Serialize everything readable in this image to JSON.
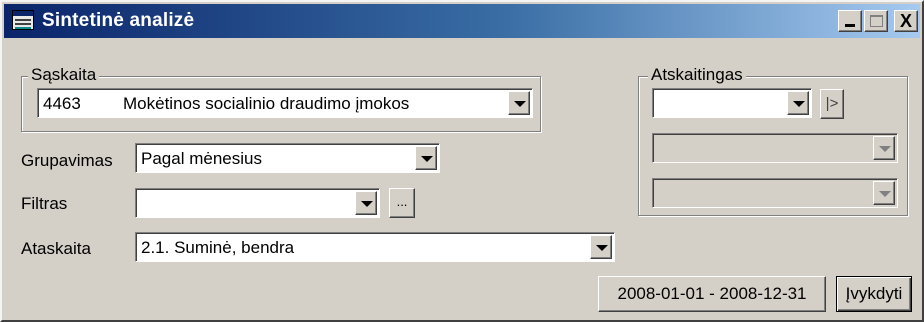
{
  "window": {
    "title": "Sintetinė analizė",
    "controls": {
      "minimize": "_",
      "maximize": "□",
      "close": "X"
    }
  },
  "account_group": {
    "label": "Sąskaita",
    "code": "4463",
    "name": "Mokėtinos socialinio draudimo įmokos"
  },
  "grouping": {
    "label": "Grupavimas",
    "value": "Pagal mėnesius"
  },
  "filter": {
    "label": "Filtras",
    "value": "",
    "ellipsis": "..."
  },
  "report": {
    "label": "Ataskaita",
    "value": "2.1. Suminė, bendra"
  },
  "accountable_group": {
    "label": "Atskaitingas",
    "next_button": "|>",
    "combos": [
      "",
      "",
      ""
    ]
  },
  "actions": {
    "period": "2008-01-01 - 2008-12-31",
    "execute": "Įvykdyti"
  },
  "colors": {
    "titlebar_start": "#0a246a",
    "titlebar_end": "#a6caf0",
    "face": "#d4d0c8"
  }
}
